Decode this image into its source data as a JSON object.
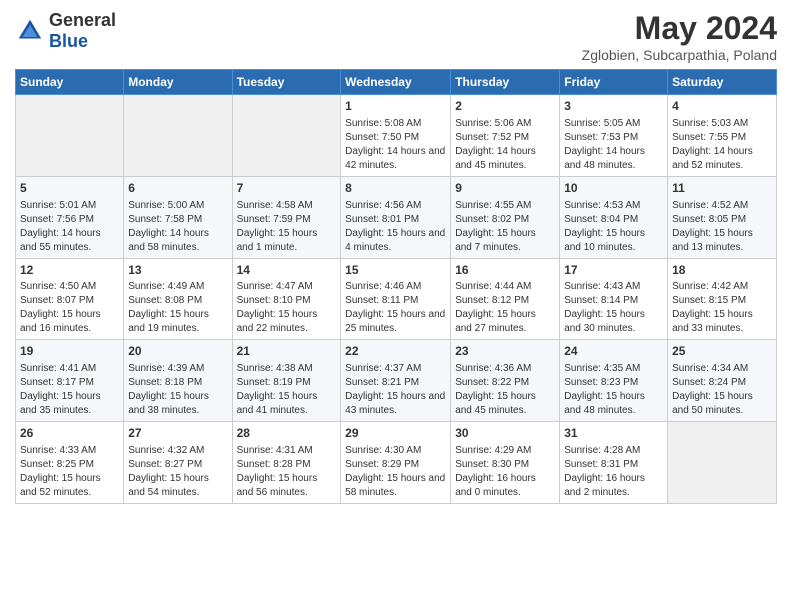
{
  "header": {
    "logo": {
      "general": "General",
      "blue": "Blue"
    },
    "title": "May 2024",
    "location": "Zglobien, Subcarpathia, Poland"
  },
  "calendar": {
    "headers": [
      "Sunday",
      "Monday",
      "Tuesday",
      "Wednesday",
      "Thursday",
      "Friday",
      "Saturday"
    ],
    "weeks": [
      {
        "days": [
          {
            "num": "",
            "empty": true
          },
          {
            "num": "",
            "empty": true
          },
          {
            "num": "",
            "empty": true
          },
          {
            "num": "1",
            "sunrise": "5:08 AM",
            "sunset": "7:50 PM",
            "daylight": "14 hours and 42 minutes."
          },
          {
            "num": "2",
            "sunrise": "5:06 AM",
            "sunset": "7:52 PM",
            "daylight": "14 hours and 45 minutes."
          },
          {
            "num": "3",
            "sunrise": "5:05 AM",
            "sunset": "7:53 PM",
            "daylight": "14 hours and 48 minutes."
          },
          {
            "num": "4",
            "sunrise": "5:03 AM",
            "sunset": "7:55 PM",
            "daylight": "14 hours and 52 minutes."
          }
        ]
      },
      {
        "days": [
          {
            "num": "5",
            "sunrise": "5:01 AM",
            "sunset": "7:56 PM",
            "daylight": "14 hours and 55 minutes."
          },
          {
            "num": "6",
            "sunrise": "5:00 AM",
            "sunset": "7:58 PM",
            "daylight": "14 hours and 58 minutes."
          },
          {
            "num": "7",
            "sunrise": "4:58 AM",
            "sunset": "7:59 PM",
            "daylight": "15 hours and 1 minute."
          },
          {
            "num": "8",
            "sunrise": "4:56 AM",
            "sunset": "8:01 PM",
            "daylight": "15 hours and 4 minutes."
          },
          {
            "num": "9",
            "sunrise": "4:55 AM",
            "sunset": "8:02 PM",
            "daylight": "15 hours and 7 minutes."
          },
          {
            "num": "10",
            "sunrise": "4:53 AM",
            "sunset": "8:04 PM",
            "daylight": "15 hours and 10 minutes."
          },
          {
            "num": "11",
            "sunrise": "4:52 AM",
            "sunset": "8:05 PM",
            "daylight": "15 hours and 13 minutes."
          }
        ]
      },
      {
        "days": [
          {
            "num": "12",
            "sunrise": "4:50 AM",
            "sunset": "8:07 PM",
            "daylight": "15 hours and 16 minutes."
          },
          {
            "num": "13",
            "sunrise": "4:49 AM",
            "sunset": "8:08 PM",
            "daylight": "15 hours and 19 minutes."
          },
          {
            "num": "14",
            "sunrise": "4:47 AM",
            "sunset": "8:10 PM",
            "daylight": "15 hours and 22 minutes."
          },
          {
            "num": "15",
            "sunrise": "4:46 AM",
            "sunset": "8:11 PM",
            "daylight": "15 hours and 25 minutes."
          },
          {
            "num": "16",
            "sunrise": "4:44 AM",
            "sunset": "8:12 PM",
            "daylight": "15 hours and 27 minutes."
          },
          {
            "num": "17",
            "sunrise": "4:43 AM",
            "sunset": "8:14 PM",
            "daylight": "15 hours and 30 minutes."
          },
          {
            "num": "18",
            "sunrise": "4:42 AM",
            "sunset": "8:15 PM",
            "daylight": "15 hours and 33 minutes."
          }
        ]
      },
      {
        "days": [
          {
            "num": "19",
            "sunrise": "4:41 AM",
            "sunset": "8:17 PM",
            "daylight": "15 hours and 35 minutes."
          },
          {
            "num": "20",
            "sunrise": "4:39 AM",
            "sunset": "8:18 PM",
            "daylight": "15 hours and 38 minutes."
          },
          {
            "num": "21",
            "sunrise": "4:38 AM",
            "sunset": "8:19 PM",
            "daylight": "15 hours and 41 minutes."
          },
          {
            "num": "22",
            "sunrise": "4:37 AM",
            "sunset": "8:21 PM",
            "daylight": "15 hours and 43 minutes."
          },
          {
            "num": "23",
            "sunrise": "4:36 AM",
            "sunset": "8:22 PM",
            "daylight": "15 hours and 45 minutes."
          },
          {
            "num": "24",
            "sunrise": "4:35 AM",
            "sunset": "8:23 PM",
            "daylight": "15 hours and 48 minutes."
          },
          {
            "num": "25",
            "sunrise": "4:34 AM",
            "sunset": "8:24 PM",
            "daylight": "15 hours and 50 minutes."
          }
        ]
      },
      {
        "days": [
          {
            "num": "26",
            "sunrise": "4:33 AM",
            "sunset": "8:25 PM",
            "daylight": "15 hours and 52 minutes."
          },
          {
            "num": "27",
            "sunrise": "4:32 AM",
            "sunset": "8:27 PM",
            "daylight": "15 hours and 54 minutes."
          },
          {
            "num": "28",
            "sunrise": "4:31 AM",
            "sunset": "8:28 PM",
            "daylight": "15 hours and 56 minutes."
          },
          {
            "num": "29",
            "sunrise": "4:30 AM",
            "sunset": "8:29 PM",
            "daylight": "15 hours and 58 minutes."
          },
          {
            "num": "30",
            "sunrise": "4:29 AM",
            "sunset": "8:30 PM",
            "daylight": "16 hours and 0 minutes."
          },
          {
            "num": "31",
            "sunrise": "4:28 AM",
            "sunset": "8:31 PM",
            "daylight": "16 hours and 2 minutes."
          },
          {
            "num": "",
            "empty": true
          }
        ]
      }
    ]
  }
}
